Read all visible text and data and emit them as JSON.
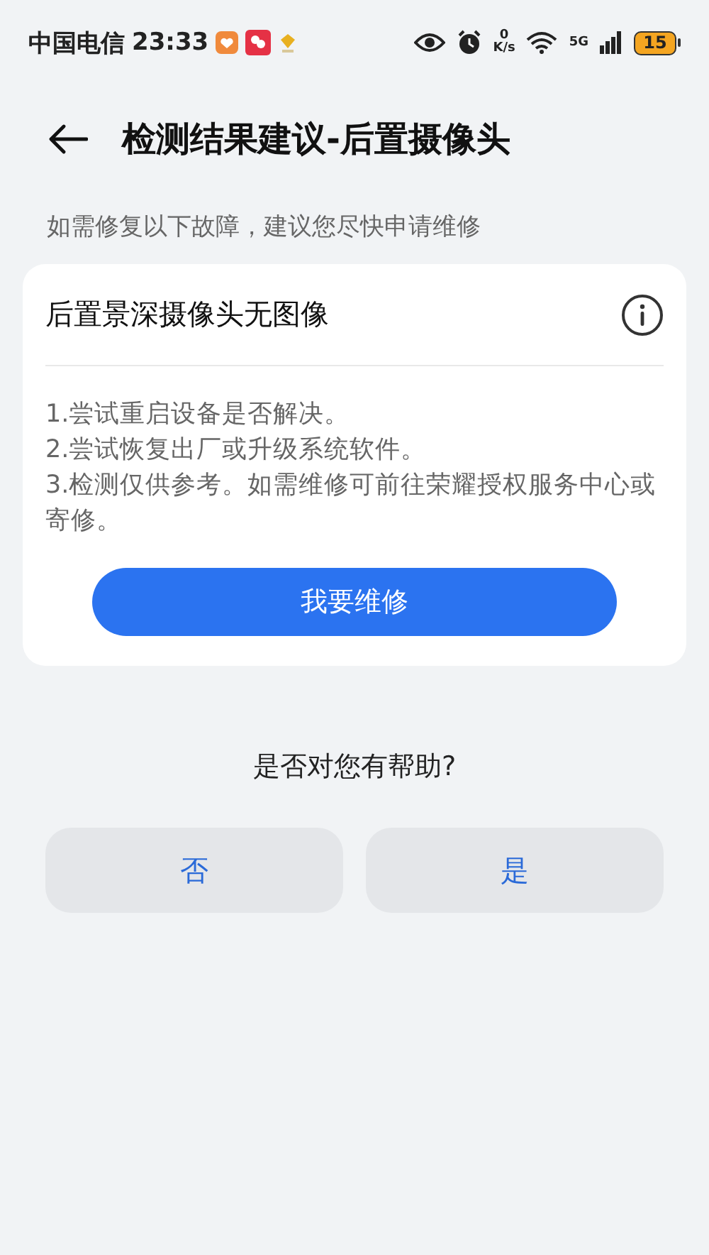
{
  "status_bar": {
    "carrier": "中国电信",
    "time": "23:33",
    "net_speed_value": "0",
    "net_speed_unit": "K/s",
    "network": "5G",
    "battery": "15"
  },
  "header": {
    "title": "检测结果建议-后置摄像头"
  },
  "subtitle": "如需修复以下故障，建议您尽快申请维修",
  "card": {
    "title": "后置景深摄像头无图像",
    "steps": [
      "1.尝试重启设备是否解决。",
      "2.尝试恢复出厂或升级系统软件。",
      "3.检测仅供参考。如需维修可前往荣耀授权服务中心或寄修。"
    ],
    "button": "我要维修"
  },
  "feedback": {
    "question": "是否对您有帮助?",
    "buttons": [
      "否",
      "是"
    ]
  }
}
